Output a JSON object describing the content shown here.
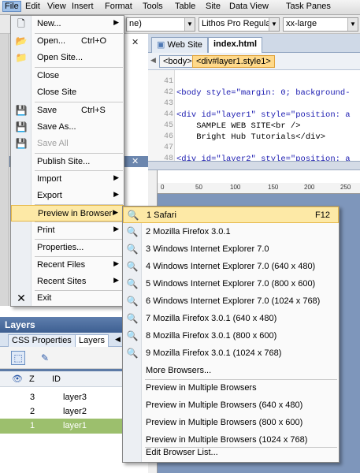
{
  "menubar": {
    "items": [
      "File",
      "Edit",
      "View",
      "Insert",
      "Format",
      "Tools",
      "Table",
      "Site",
      "Data View",
      "Task Panes"
    ]
  },
  "toolbar": {
    "style_combo": "ne)",
    "font_combo": "Lithos Pro Regular",
    "size_combo": "xx-large"
  },
  "doc": {
    "tabs": [
      "Web Site",
      "index.html"
    ],
    "tags": [
      "<body>",
      "<div#layer1.style1>"
    ],
    "line_numbers": [
      "41",
      "42",
      "43",
      "44",
      "45",
      "46",
      "47",
      "48"
    ],
    "code_lines": [
      "",
      "<body style=\"margin: 0; background-",
      "",
      "<div id=\"layer1\" style=\"position: a",
      "    SAMPLE WEB SITE<br />",
      "    Bright Hub Tutorials</div>",
      "",
      "<div id=\"layer2\" style=\"position: a"
    ],
    "ruler_ticks": [
      "0",
      "50",
      "100",
      "150",
      "200",
      "250"
    ]
  },
  "file_menu": {
    "items": [
      {
        "label": "New...",
        "shortcut": "",
        "submenu": true,
        "icon": "new-page-icon",
        "enabled": true
      },
      {
        "label": "Open...",
        "shortcut": "Ctrl+O",
        "submenu": false,
        "icon": "open-folder-icon",
        "enabled": true
      },
      {
        "label": "Open Site...",
        "shortcut": "",
        "submenu": false,
        "icon": "open-site-icon",
        "enabled": true
      },
      {
        "label": "Close",
        "shortcut": "",
        "submenu": false,
        "icon": "",
        "enabled": true
      },
      {
        "label": "Close Site",
        "shortcut": "",
        "submenu": false,
        "icon": "",
        "enabled": true
      },
      {
        "label": "Save",
        "shortcut": "Ctrl+S",
        "submenu": false,
        "icon": "save-icon",
        "enabled": true
      },
      {
        "label": "Save As...",
        "shortcut": "",
        "submenu": false,
        "icon": "save-as-icon",
        "enabled": true
      },
      {
        "label": "Save All",
        "shortcut": "",
        "submenu": false,
        "icon": "save-all-icon",
        "enabled": false
      },
      {
        "label": "Publish Site...",
        "shortcut": "",
        "submenu": false,
        "icon": "",
        "enabled": true
      },
      {
        "label": "Import",
        "shortcut": "",
        "submenu": true,
        "icon": "",
        "enabled": true
      },
      {
        "label": "Export",
        "shortcut": "",
        "submenu": true,
        "icon": "",
        "enabled": true
      },
      {
        "label": "Preview in Browser",
        "shortcut": "",
        "submenu": true,
        "icon": "",
        "enabled": true
      },
      {
        "label": "Print",
        "shortcut": "",
        "submenu": true,
        "icon": "",
        "enabled": true
      },
      {
        "label": "Properties...",
        "shortcut": "",
        "submenu": false,
        "icon": "",
        "enabled": true
      },
      {
        "label": "Recent Files",
        "shortcut": "",
        "submenu": true,
        "icon": "",
        "enabled": true
      },
      {
        "label": "Recent Sites",
        "shortcut": "",
        "submenu": true,
        "icon": "",
        "enabled": true
      },
      {
        "label": "Exit",
        "shortcut": "",
        "submenu": false,
        "icon": "close-x-icon",
        "enabled": true
      }
    ]
  },
  "browser_menu": {
    "items": [
      {
        "label": "1 Safari",
        "shortcut": "F12"
      },
      {
        "label": "2 Mozilla Firefox 3.0.1",
        "shortcut": ""
      },
      {
        "label": "3 Windows Internet Explorer 7.0",
        "shortcut": ""
      },
      {
        "label": "4 Windows Internet Explorer 7.0 (640 x 480)",
        "shortcut": ""
      },
      {
        "label": "5 Windows Internet Explorer 7.0 (800 x 600)",
        "shortcut": ""
      },
      {
        "label": "6 Windows Internet Explorer 7.0 (1024 x 768)",
        "shortcut": ""
      },
      {
        "label": "7 Mozilla Firefox 3.0.1 (640 x 480)",
        "shortcut": ""
      },
      {
        "label": "8 Mozilla Firefox 3.0.1 (800 x 600)",
        "shortcut": ""
      },
      {
        "label": "9 Mozilla Firefox 3.0.1 (1024 x 768)",
        "shortcut": ""
      }
    ],
    "more": "More Browsers...",
    "multi": [
      "Preview in Multiple Browsers",
      "Preview in Multiple Browsers (640 x 480)",
      "Preview in Multiple Browsers (800 x 600)",
      "Preview in Multiple Browsers (1024 x 768)"
    ],
    "edit": "Edit Browser List..."
  },
  "layers_panel": {
    "title": "Layers",
    "tabs": [
      "CSS Properties",
      "Layers"
    ],
    "columns": [
      "Z",
      "ID"
    ],
    "rows": [
      {
        "z": "3",
        "id": "layer3"
      },
      {
        "z": "2",
        "id": "layer2"
      },
      {
        "z": "1",
        "id": "layer1"
      }
    ],
    "selected_row": "layer1"
  }
}
